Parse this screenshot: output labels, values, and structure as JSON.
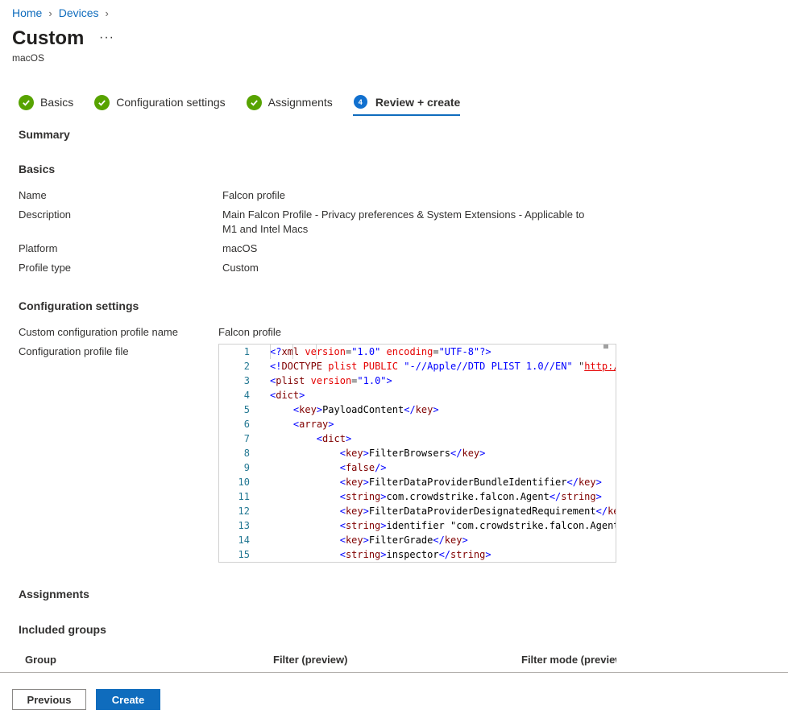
{
  "breadcrumb": {
    "home": "Home",
    "devices": "Devices"
  },
  "page": {
    "title": "Custom",
    "more": "···",
    "subtitle": "macOS"
  },
  "steps": [
    {
      "label": "Basics",
      "state": "done"
    },
    {
      "label": "Configuration settings",
      "state": "done"
    },
    {
      "label": "Assignments",
      "state": "done"
    },
    {
      "label": "Review + create",
      "state": "active",
      "number": "4"
    }
  ],
  "summary": {
    "heading": "Summary",
    "basics": {
      "heading": "Basics",
      "name_label": "Name",
      "name_value": "Falcon profile",
      "description_label": "Description",
      "description_line1": "Main Falcon Profile - Privacy preferences & System Extensions - Applicable to",
      "description_line2": "M1 and Intel Macs",
      "platform_label": "Platform",
      "platform_value": "macOS",
      "profile_type_label": "Profile type",
      "profile_type_value": "Custom"
    },
    "config": {
      "heading": "Configuration settings",
      "profile_name_label": "Custom configuration profile name",
      "profile_name_value": "Falcon profile",
      "profile_file_label": "Configuration profile file"
    },
    "assignments": {
      "heading": "Assignments",
      "included_heading": "Included groups",
      "columns": [
        "Group",
        "Filter (preview)",
        "Filter mode (preview)"
      ]
    }
  },
  "code": {
    "lines": [
      {
        "n": "1",
        "text": "<?xml version=\"1.0\" encoding=\"UTF-8\"?>"
      },
      {
        "n": "2",
        "text": "<!DOCTYPE plist PUBLIC \"-//Apple//DTD PLIST 1.0//EN\" \"http:/"
      },
      {
        "n": "3",
        "text": "<plist version=\"1.0\">"
      },
      {
        "n": "4",
        "text": "<dict>"
      },
      {
        "n": "5",
        "text": "    <key>PayloadContent</key>"
      },
      {
        "n": "6",
        "text": "    <array>"
      },
      {
        "n": "7",
        "text": "        <dict>"
      },
      {
        "n": "8",
        "text": "            <key>FilterBrowsers</key>"
      },
      {
        "n": "9",
        "text": "            <false/>"
      },
      {
        "n": "10",
        "text": "            <key>FilterDataProviderBundleIdentifier</key>"
      },
      {
        "n": "11",
        "text": "            <string>com.crowdstrike.falcon.Agent</string>"
      },
      {
        "n": "12",
        "text": "            <key>FilterDataProviderDesignatedRequirement</ke"
      },
      {
        "n": "13",
        "text": "            <string>identifier \"com.crowdstrike.falcon.Agent"
      },
      {
        "n": "14",
        "text": "            <key>FilterGrade</key>"
      },
      {
        "n": "15",
        "text": "            <string>inspector</string>"
      }
    ]
  },
  "footer": {
    "previous": "Previous",
    "create": "Create"
  },
  "colors": {
    "accent": "#0f6cbd",
    "success": "#57a300"
  }
}
